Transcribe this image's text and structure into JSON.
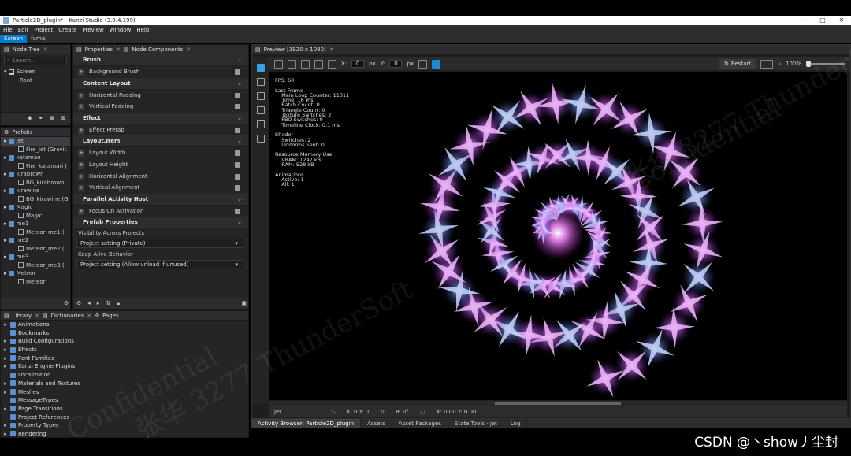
{
  "window": {
    "title": "Particle2D_plugin* - Kanzi Studio (3.9.4.199)",
    "controls": [
      "—",
      "□",
      "✕"
    ]
  },
  "menu": [
    "File",
    "Edit",
    "Project",
    "Create",
    "Preview",
    "Window",
    "Help"
  ],
  "workspace_tabs": [
    {
      "label": "Screen",
      "active": true
    },
    {
      "label": "fumai",
      "active": false
    }
  ],
  "node_tree": {
    "tab": "Node Tree",
    "search_placeholder": "Search...",
    "items": [
      "Screen",
      "Root"
    ]
  },
  "prefabs": {
    "tab": "Prefabs",
    "items": [
      {
        "label": "jet",
        "level": 0,
        "selected": true
      },
      {
        "label": "Fire_jet (Gravit",
        "level": 1
      },
      {
        "label": "kataman",
        "level": 0
      },
      {
        "label": "Fire_katamari (",
        "level": 1
      },
      {
        "label": "kirabrown",
        "level": 0
      },
      {
        "label": "BG_kirabrown",
        "level": 1
      },
      {
        "label": "kirawine",
        "level": 0
      },
      {
        "label": "BG_kirawine (G",
        "level": 1
      },
      {
        "label": "Magic",
        "level": 0
      },
      {
        "label": "Magic",
        "level": 1
      },
      {
        "label": "me1",
        "level": 0
      },
      {
        "label": "Meteor_me1 (",
        "level": 1
      },
      {
        "label": "me2",
        "level": 0
      },
      {
        "label": "Meteor_me2 (",
        "level": 1
      },
      {
        "label": "me3",
        "level": 0
      },
      {
        "label": "Meteor_me3 (",
        "level": 1
      },
      {
        "label": "Meteor",
        "level": 0
      },
      {
        "label": "Meteor",
        "level": 1
      }
    ]
  },
  "properties": {
    "tabs": [
      "Properties",
      "Node Components"
    ],
    "sections": [
      {
        "title": "Brush",
        "rows": [
          "Background Brush"
        ]
      },
      {
        "title": "Content Layout",
        "rows": [
          "Horizontal Padding",
          "Vertical Padding"
        ]
      },
      {
        "title": "Effect",
        "rows": [
          "Effect Prefab"
        ]
      },
      {
        "title": "Layout.Item",
        "rows": [
          "Layout Width",
          "Layout Height",
          "Horizontal Alignment",
          "Vertical Alignment"
        ]
      },
      {
        "title": "Parallel Activity Host",
        "rows": [
          "Focus On Activation"
        ]
      },
      {
        "title": "Prefab Properties",
        "rows": []
      }
    ],
    "visibility_label": "Visibility Across Projects",
    "visibility_value": "Project setting (Private)",
    "keepalive_label": "Keep Alive Behavior",
    "keepalive_value": "Project setting (Allow unload if unused)"
  },
  "library": {
    "tabs": [
      "Library",
      "Dictionaries",
      "Pages"
    ],
    "items": [
      "Animations",
      "Bookmarks",
      "Build Configurations",
      "Effects",
      "Font Families",
      "Kanzi Engine Plugins",
      "Localization",
      "Materials and Textures",
      "Meshes",
      "MessageTypes",
      "Page Transitions",
      "Project References",
      "Property Types",
      "Rendering"
    ]
  },
  "preview": {
    "tab": "Preview [1920 x 1080]",
    "x_label": "X:",
    "x_value": "0",
    "x_unit": "px",
    "y_label": "Y:",
    "y_value": "0",
    "y_unit": "px",
    "restart_label": "Restart",
    "zoom": "100%",
    "stats": "FPS: 60\n\nLast Frame\n    Main Loop Counter: 11311\n    Time: 16 ms\n    Batch Count: 0\n    Triangle Count: 0\n    Texture Switches: 2\n    FBO Switches: 0\n    Timeline Clock: 0.1 ms\n\nShader\n    Switches: 2\n    Uniforms Sent: 0\n\nResource Memory Use\n    VRAM: 1247 kB\n    RAM: 528 kB\n\nAnimations\n    Active: 1\n    All: 1",
    "status": {
      "node": "jet",
      "pos": "X: 0  Y: 0",
      "rot": "R: 0°",
      "cursor": "X: 0.00  Y: 0.00"
    }
  },
  "bottom_tabs": [
    {
      "label": "Activity Browser: Particle2D_plugin",
      "active": true
    },
    {
      "label": "Assets",
      "active": false
    },
    {
      "label": "Asset Packages",
      "active": false
    },
    {
      "label": "State Tools - jet",
      "active": false
    },
    {
      "label": "Log",
      "active": false
    }
  ],
  "watermarks": [
    "张华 3277 ThunderSoft",
    "Confidential",
    "张华 3277 ThunderSoft",
    "Confidential"
  ],
  "footer_credit": "CSDN @丶show丿尘封",
  "colors": {
    "accent": "#007acc",
    "particle_pink": "#e070ff",
    "particle_blue": "#8aa8ff"
  }
}
